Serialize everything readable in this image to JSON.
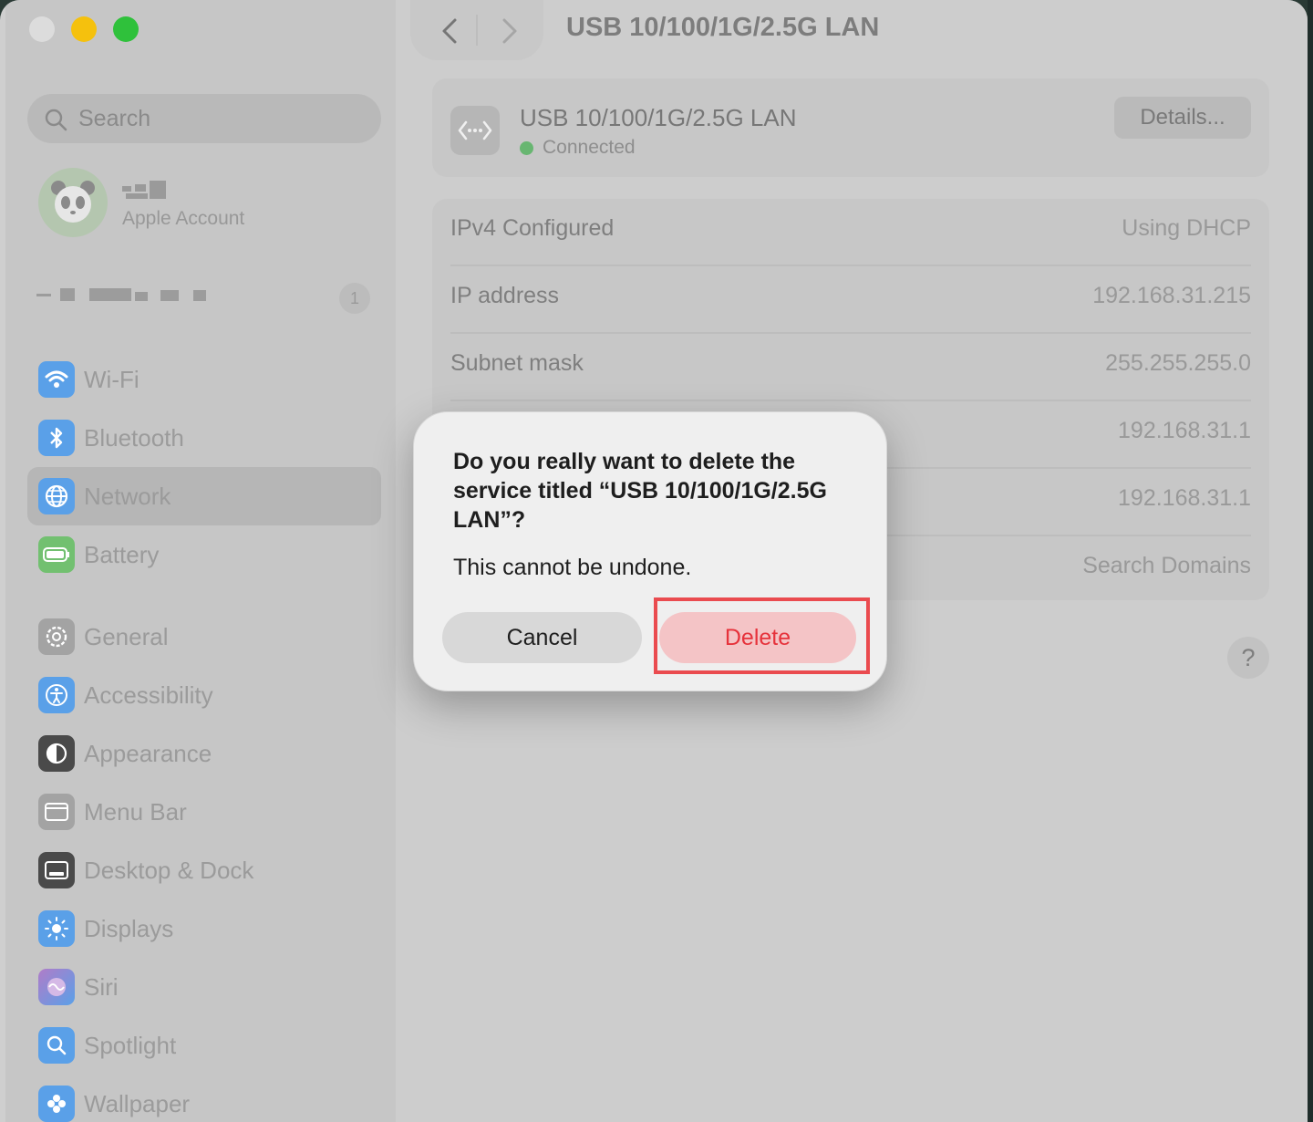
{
  "window": {
    "title": "USB 10/100/1G/2.5G LAN"
  },
  "sidebar": {
    "search_placeholder": "Search",
    "account": {
      "subtitle": "Apple Account"
    },
    "notification_badge": "1",
    "items": [
      {
        "label": "Wi-Fi",
        "icon": "wifi-icon",
        "color": "#5aa0e8"
      },
      {
        "label": "Bluetooth",
        "icon": "bluetooth-icon",
        "color": "#5aa0e8"
      },
      {
        "label": "Network",
        "icon": "globe-icon",
        "color": "#5aa0e8",
        "selected": true
      },
      {
        "label": "Battery",
        "icon": "battery-icon",
        "color": "#72c070"
      },
      {
        "label": "General",
        "icon": "gear-icon",
        "color": "#a3a3a3"
      },
      {
        "label": "Accessibility",
        "icon": "accessibility-icon",
        "color": "#5aa0e8"
      },
      {
        "label": "Appearance",
        "icon": "appearance-icon",
        "color": "#4a4a4a"
      },
      {
        "label": "Menu Bar",
        "icon": "menubar-icon",
        "color": "#a3a3a3"
      },
      {
        "label": "Desktop & Dock",
        "icon": "dock-icon",
        "color": "#4a4a4a"
      },
      {
        "label": "Displays",
        "icon": "sun-icon",
        "color": "#5aa0e8"
      },
      {
        "label": "Siri",
        "icon": "siri-icon",
        "color": "#b07cc8"
      },
      {
        "label": "Spotlight",
        "icon": "magnifier-icon",
        "color": "#5aa0e8"
      },
      {
        "label": "Wallpaper",
        "icon": "flower-icon",
        "color": "#5aa0e8"
      }
    ]
  },
  "service": {
    "name": "USB 10/100/1G/2.5G LAN",
    "status": "Connected",
    "status_color": "#68b671",
    "details_label": "Details..."
  },
  "info_rows": [
    {
      "label": "IPv4 Configured",
      "value": "Using DHCP"
    },
    {
      "label": "IP address",
      "value": "192.168.31.215"
    },
    {
      "label": "Subnet mask",
      "value": "255.255.255.0"
    },
    {
      "label": "",
      "value": "192.168.31.1"
    },
    {
      "label": "",
      "value": "192.168.31.1"
    },
    {
      "label": "",
      "value": "Search Domains"
    }
  ],
  "help_label": "?",
  "dialog": {
    "title": "Do you really want to delete the service titled “USB 10/100/1G/2.5G LAN”?",
    "message": "This cannot be undone.",
    "cancel_label": "Cancel",
    "delete_label": "Delete",
    "delete_color": "#e6323b"
  }
}
